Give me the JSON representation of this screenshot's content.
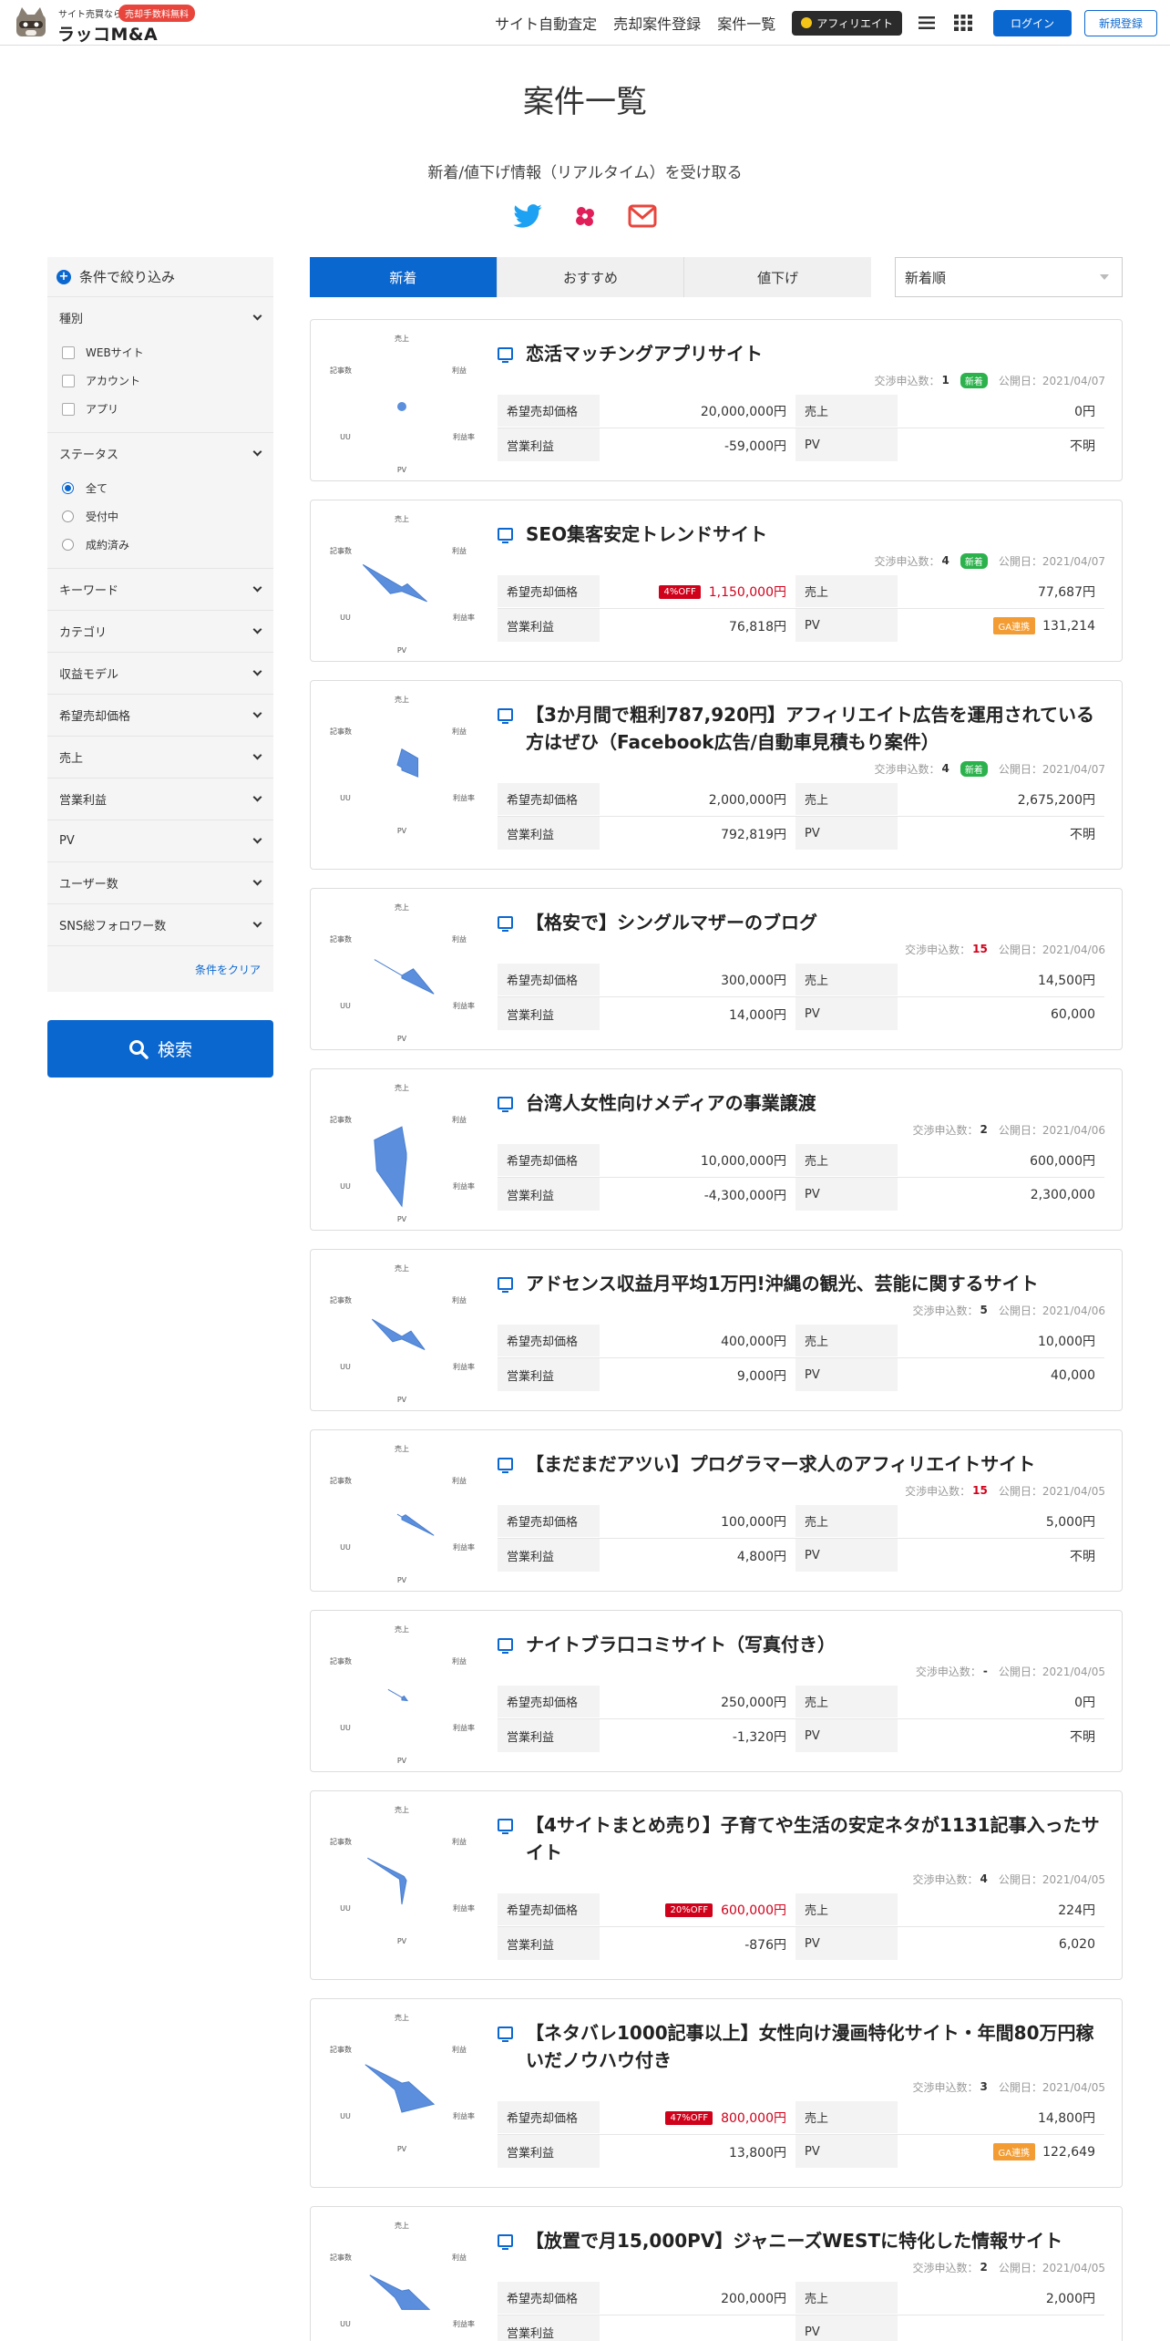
{
  "header": {
    "logo_tagline": "サイト売買なら",
    "logo_badge": "売却手数料無料",
    "logo_name": "ラッコM&A",
    "nav": [
      "サイト自動査定",
      "売却案件登録",
      "案件一覧"
    ],
    "affiliate_label": "アフィリエイト",
    "login_label": "ログイン",
    "signup_label": "新規登録"
  },
  "page": {
    "title": "案件一覧",
    "subscribe_text": "新着/値下げ情報（リアルタイム）を受け取る",
    "social_icons": [
      "twitter-icon",
      "slack-icon",
      "mail-icon"
    ]
  },
  "sidebar": {
    "heading": "条件で絞り込み",
    "sections": [
      {
        "label": "種別",
        "options": [
          "WEBサイト",
          "アカウント",
          "アプリ"
        ]
      },
      {
        "label": "ステータス",
        "options": [
          "全て",
          "受付中",
          "成約済み"
        ],
        "selected": "全て"
      },
      {
        "label": "キーワード"
      },
      {
        "label": "カテゴリ"
      },
      {
        "label": "収益モデル"
      },
      {
        "label": "希望売却価格"
      },
      {
        "label": "売上"
      },
      {
        "label": "営業利益"
      },
      {
        "label": "PV"
      },
      {
        "label": "ユーザー数"
      },
      {
        "label": "SNS総フォロワー数"
      }
    ],
    "clear_label": "条件をクリア",
    "search_label": "検索"
  },
  "tabs": [
    {
      "label": "新着",
      "active": true
    },
    {
      "label": "おすすめ",
      "active": false
    },
    {
      "label": "値下げ",
      "active": false
    }
  ],
  "sort": {
    "selected": "新着順"
  },
  "radar_labels": {
    "top": "売上",
    "top_right": "利益",
    "top_left": "記事数",
    "bottom_right": "利益率",
    "bottom_left": "UU",
    "bottom": "PV"
  },
  "labels": {
    "negotiations": "交渉申込数：",
    "published": "公開日：",
    "new_badge": "新着",
    "price": "希望売却価格",
    "sales": "売上",
    "profit": "営業利益",
    "pv": "PV",
    "ga_badge": "GA連携"
  },
  "listings": [
    {
      "title": "恋活マッチングアプリサイト",
      "negotiations": "1",
      "hot": false,
      "is_new": true,
      "published": "2021/04/07",
      "discount": "",
      "price": "20,000,000円",
      "sales": "0円",
      "profit": "-59,000円",
      "pv": "不明",
      "ga": false,
      "radar": [
        0,
        0,
        0,
        0,
        0,
        0
      ]
    },
    {
      "title": "SEO集客安定トレンドサイト",
      "negotiations": "4",
      "hot": false,
      "is_new": true,
      "published": "2021/04/07",
      "discount": "4%OFF",
      "price": "1,150,000円",
      "sales": "77,687円",
      "profit": "76,818円",
      "pv": "131,214",
      "ga": true,
      "radar": [
        0,
        0.12,
        0.55,
        0.08,
        0.25,
        0.85
      ]
    },
    {
      "title": "【3か月間で粗利787,920円】アフィリエイト広告を運用されている方はぜひ（Facebook広告/自動車見積もり案件）",
      "negotiations": "4",
      "hot": false,
      "is_new": true,
      "published": "2021/04/07",
      "discount": "",
      "price": "2,000,000円",
      "sales": "2,675,200円",
      "profit": "792,819円",
      "pv": "不明",
      "ga": false,
      "radar": [
        0.35,
        0.35,
        0.35,
        0.05,
        0,
        0.1
      ]
    },
    {
      "title": "【格安で】シングルマザーのブログ",
      "negotiations": "15",
      "hot": true,
      "is_new": false,
      "published": "2021/04/06",
      "discount": "",
      "price": "300,000円",
      "sales": "14,500円",
      "profit": "14,000円",
      "pv": "60,000",
      "ga": false,
      "radar": [
        0,
        0.25,
        0.7,
        0.05,
        0,
        0.6
      ]
    },
    {
      "title": "台湾人女性向けメディアの事業譲渡",
      "negotiations": "2",
      "hot": false,
      "is_new": false,
      "published": "2021/04/06",
      "discount": "",
      "price": "10,000,000円",
      "sales": "600,000円",
      "profit": "-4,300,000円",
      "pv": "2,300,000",
      "ga": false,
      "radar": [
        0.55,
        0.1,
        0.1,
        0.95,
        0.55,
        0.6
      ]
    },
    {
      "title": "アドセンス収益月平均1万円!沖縄の観光、芸能に関するサイト",
      "negotiations": "5",
      "hot": false,
      "is_new": false,
      "published": "2021/04/06",
      "discount": "",
      "price": "400,000円",
      "sales": "10,000円",
      "profit": "9,000円",
      "pv": "40,000",
      "ga": false,
      "radar": [
        0,
        0.2,
        0.5,
        0.05,
        0.2,
        0.65
      ]
    },
    {
      "title": "【まだまだアツい】プログラマー求人のアフィリエイトサイト",
      "negotiations": "15",
      "hot": true,
      "is_new": false,
      "published": "2021/04/05",
      "discount": "",
      "price": "100,000円",
      "sales": "5,000円",
      "profit": "4,800円",
      "pv": "不明",
      "ga": false,
      "radar": [
        0,
        0.08,
        0.7,
        0.05,
        0,
        0.1
      ]
    },
    {
      "title": "ナイトブラ口コミサイト（写真付き）",
      "negotiations": "-",
      "hot": false,
      "is_new": false,
      "published": "2021/04/05",
      "discount": "",
      "price": "250,000円",
      "sales": "0円",
      "profit": "-1,320円",
      "pv": "不明",
      "ga": false,
      "radar": [
        0,
        0.05,
        0.12,
        0.05,
        0,
        0.3
      ]
    },
    {
      "title": "【4サイトまとめ売り】子育てや生活の安定ネタが1131記事入ったサイト",
      "negotiations": "4",
      "hot": false,
      "is_new": false,
      "published": "2021/04/05",
      "discount": "20%OFF",
      "price": "600,000円",
      "sales": "224円",
      "profit": "-876円",
      "pv": "6,020",
      "ga": false,
      "radar": [
        0.05,
        0.05,
        0.1,
        0.5,
        0.05,
        0.75
      ]
    },
    {
      "title": "【ネタバレ1000記事以上】女性向け漫画特化サイト・年間80万円稼いだノウハウ付き",
      "negotiations": "3",
      "hot": false,
      "is_new": false,
      "published": "2021/04/05",
      "discount": "47%OFF",
      "price": "800,000円",
      "sales": "14,800円",
      "profit": "13,800円",
      "pv": "122,649",
      "ga": true,
      "radar": [
        0.05,
        0.15,
        0.7,
        0.5,
        0.15,
        0.8
      ]
    },
    {
      "title": "【放置で月15,000PV】ジャニーズWESTに特化した情報サイト",
      "negotiations": "2",
      "hot": false,
      "is_new": false,
      "published": "2021/04/05",
      "discount": "",
      "price": "200,000円",
      "sales": "2,000円",
      "profit": "",
      "pv": "",
      "ga": false,
      "radar": [
        0.05,
        0.15,
        0.6,
        0.3,
        0.15,
        0.7
      ]
    }
  ]
}
